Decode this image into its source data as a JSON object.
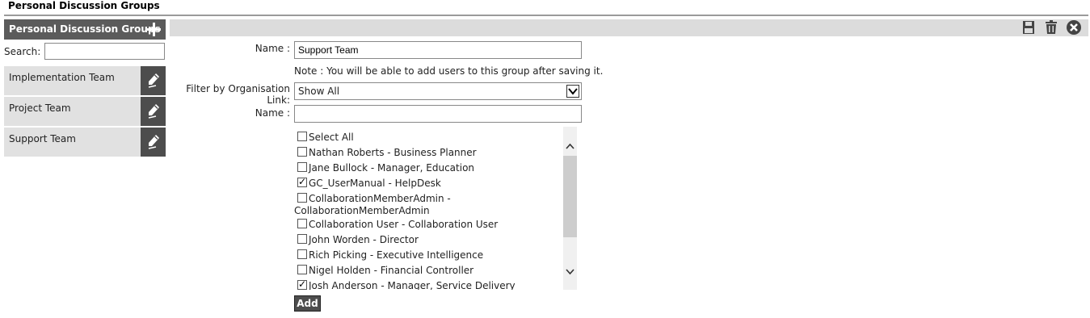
{
  "page": {
    "title": "Personal Discussion Groups"
  },
  "sidebar": {
    "header": "Personal Discussion Groups",
    "search_label": "Search:",
    "search_value": "",
    "groups": [
      {
        "label": "Implementation Team"
      },
      {
        "label": "Project Team"
      },
      {
        "label": "Support Team"
      }
    ]
  },
  "toolbar": {
    "icons": [
      "save-icon",
      "delete-icon",
      "close-icon"
    ]
  },
  "form": {
    "name_label": "Name :",
    "name_value": "Support Team",
    "note": "Note : You will be able to add users to this group after saving it.",
    "filter_label": "Filter by Organisation Link:",
    "filter_value": "Show All",
    "name2_label": "Name :",
    "name2_value": "",
    "users": [
      {
        "label": "Select All",
        "checked": false
      },
      {
        "label": "Nathan Roberts - Business Planner",
        "checked": false
      },
      {
        "label": "Jane Bullock - Manager, Education",
        "checked": false
      },
      {
        "label": "GC_UserManual - HelpDesk",
        "checked": true
      },
      {
        "label": "CollaborationMemberAdmin -",
        "label2": "CollaborationMemberAdmin",
        "checked": false
      },
      {
        "label": "Collaboration User - Collaboration User",
        "checked": false
      },
      {
        "label": "John Worden - Director",
        "checked": false
      },
      {
        "label": "Rich Picking - Executive Intelligence",
        "checked": false
      },
      {
        "label": "Nigel Holden - Financial Controller",
        "checked": false
      },
      {
        "label": "Josh Anderson - Manager, Service Delivery",
        "checked": true
      }
    ],
    "add_button": "Add"
  },
  "colors": {
    "header_bg": "#5b5b5b",
    "item_bg": "#e1e1e1",
    "toolbar_bg": "#dcdcdc",
    "button_bg": "#4d4d4d"
  }
}
